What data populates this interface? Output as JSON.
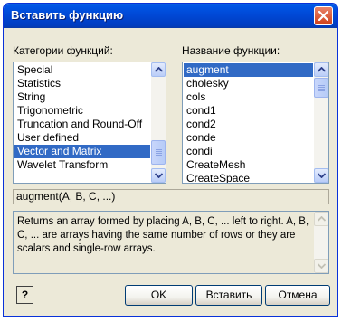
{
  "window": {
    "title": "Вставить функцию"
  },
  "categories": {
    "label": "Категории функций:",
    "items": [
      "Special",
      "Statistics",
      "String",
      "Trigonometric",
      "Truncation and Round-Off",
      "User defined",
      "Vector and Matrix",
      "Wavelet Transform"
    ],
    "selected": "Vector and Matrix"
  },
  "functions": {
    "label": "Название функции:",
    "items": [
      "augment",
      "cholesky",
      "cols",
      "cond1",
      "cond2",
      "conde",
      "condi",
      "CreateMesh",
      "CreateSpace"
    ],
    "selected": "augment"
  },
  "syntax": "augment(A, B, C, ...)",
  "description": "Returns an array formed by placing A, B, C, ... left to right. A, B, C, ... are arrays having the same number of rows or they are scalars and single-row arrays.",
  "buttons": {
    "help": "?",
    "ok": "OK",
    "insert": "Вставить",
    "cancel": "Отмена"
  },
  "icons": {
    "close": "close-icon",
    "scroll_up": "arrow-up-icon",
    "scroll_down": "arrow-down-icon",
    "help": "help-icon"
  },
  "colors": {
    "title_bar": "#0047d4",
    "selection": "#316ac5",
    "close_button": "#d04018"
  }
}
